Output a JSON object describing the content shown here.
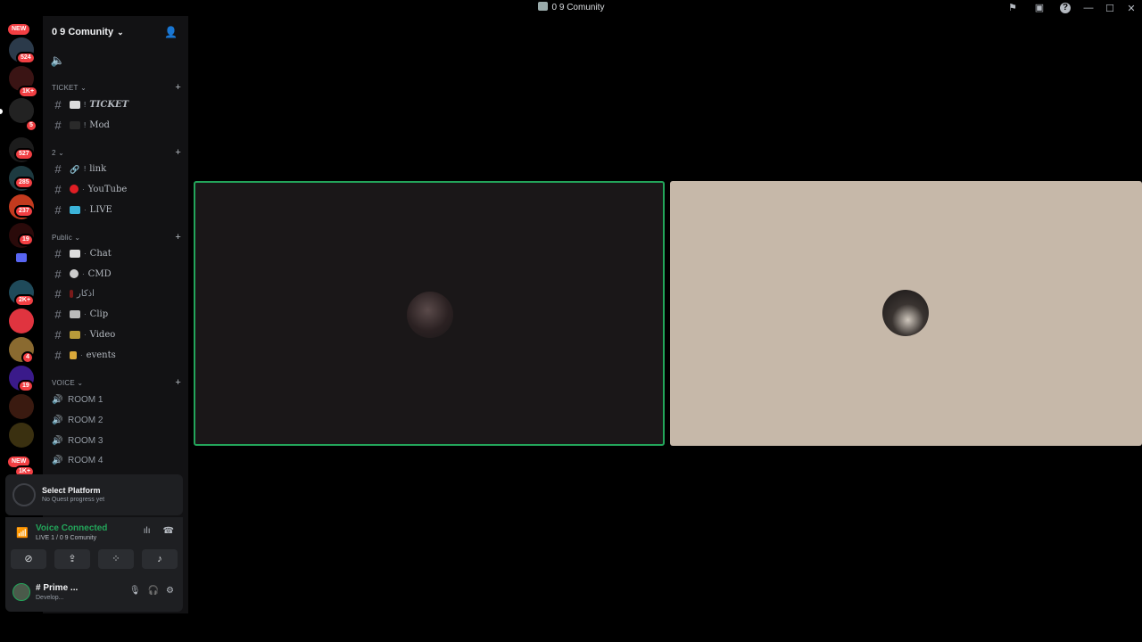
{
  "window": {
    "title": "0 9 Comunity",
    "controls": [
      "minimize",
      "maximize",
      "close"
    ]
  },
  "rail": {
    "new_label": "NEW",
    "badges": [
      "524",
      "1K+",
      "5",
      "527",
      "285",
      "237",
      "19",
      "2K+",
      "4",
      "19",
      "1K+"
    ]
  },
  "server": {
    "name": "0 9 Comunity"
  },
  "categories": {
    "ticket": "TICKET",
    "two": "2",
    "public": "Public",
    "voice": "VOICE"
  },
  "channels": {
    "ticket": "TICKET",
    "mod": "Mod",
    "link": "link",
    "youtube": "YouTube",
    "live": "LIVE",
    "chat": "Chat",
    "cmd": "CMD",
    "adhkar": "اذكار",
    "clip": "Clip",
    "video": "Video",
    "events": "events"
  },
  "voice_channels": [
    "ROOM 1",
    "ROOM 2",
    "ROOM 3",
    "ROOM 4"
  ],
  "quest": {
    "title": "Select Platform",
    "subtitle": "No Quest progress yet"
  },
  "voice_panel": {
    "status": "Voice Connected",
    "location": "LIVE 1 / 0 9 Comunity"
  },
  "user_panel": {
    "name": "# Prime ...",
    "status": "Develop..."
  },
  "colors": {
    "accent_green": "#23a55a",
    "badge_red": "#f23f43",
    "sidebar_bg": "#121214",
    "tile_light": "#c6b8a9"
  }
}
